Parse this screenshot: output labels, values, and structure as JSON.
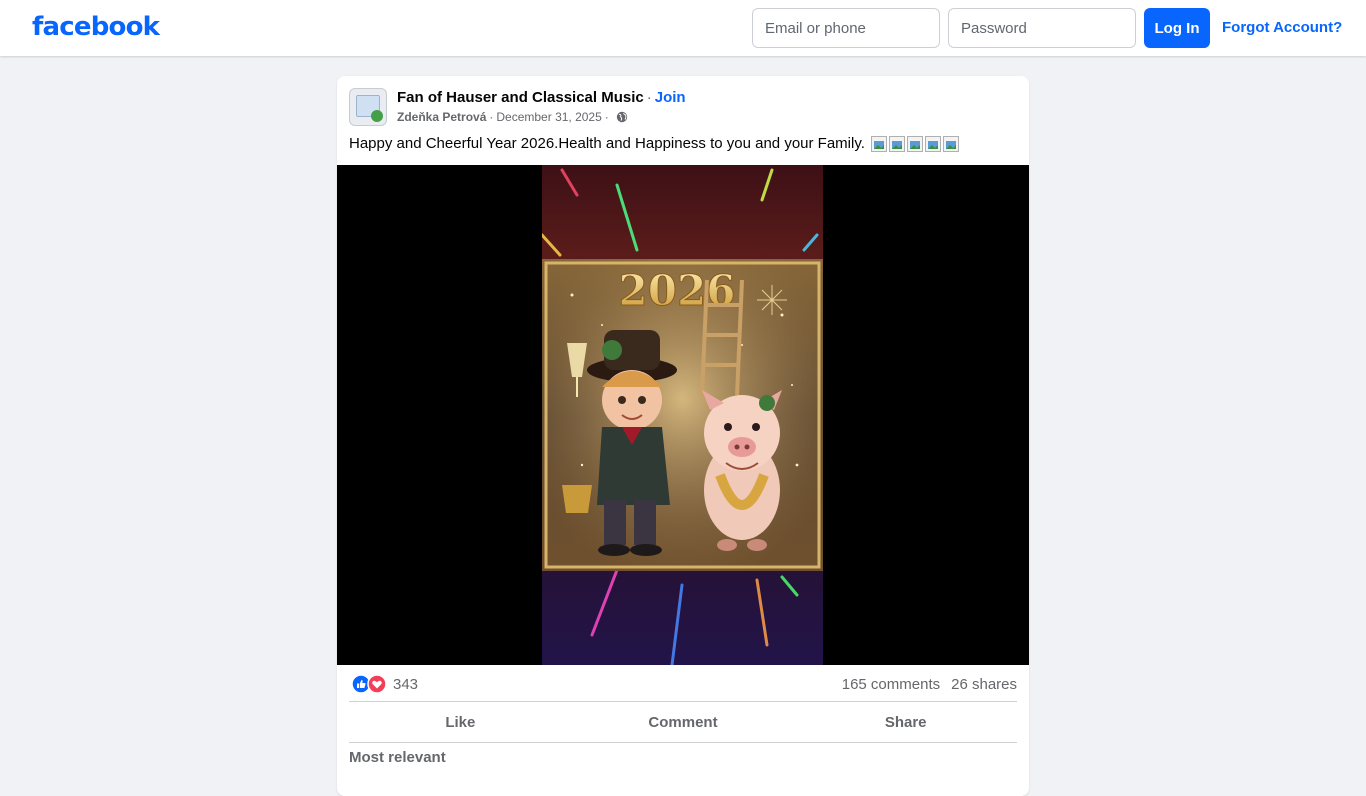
{
  "header": {
    "logo": "facebook",
    "email_placeholder": "Email or phone",
    "password_placeholder": "Password",
    "login_label": "Log In",
    "forgot_label": "Forgot Account?"
  },
  "post": {
    "group_name": "Fan of Hauser and Classical Music",
    "separator": "·",
    "join_label": "Join",
    "author": "Zdeňka Petrová",
    "date": "December 31, 2025",
    "privacy_icon": "globe-icon",
    "text": "Happy and Cheerful Year 2026.Health and Happiness to you and your Family.",
    "broken_emoji_count": 5,
    "image_year_text": "2026"
  },
  "engagement": {
    "reactions": [
      "like-icon",
      "love-icon"
    ],
    "reaction_count": "343",
    "comments": "165 comments",
    "shares": "26 shares"
  },
  "actions": {
    "like": "Like",
    "comment": "Comment",
    "share": "Share"
  },
  "comments": {
    "sort_label": "Most relevant"
  },
  "colors": {
    "brand": "#0866ff",
    "page_bg": "#f0f2f5",
    "secondary_text": "#65676b",
    "love": "#f33e58"
  }
}
